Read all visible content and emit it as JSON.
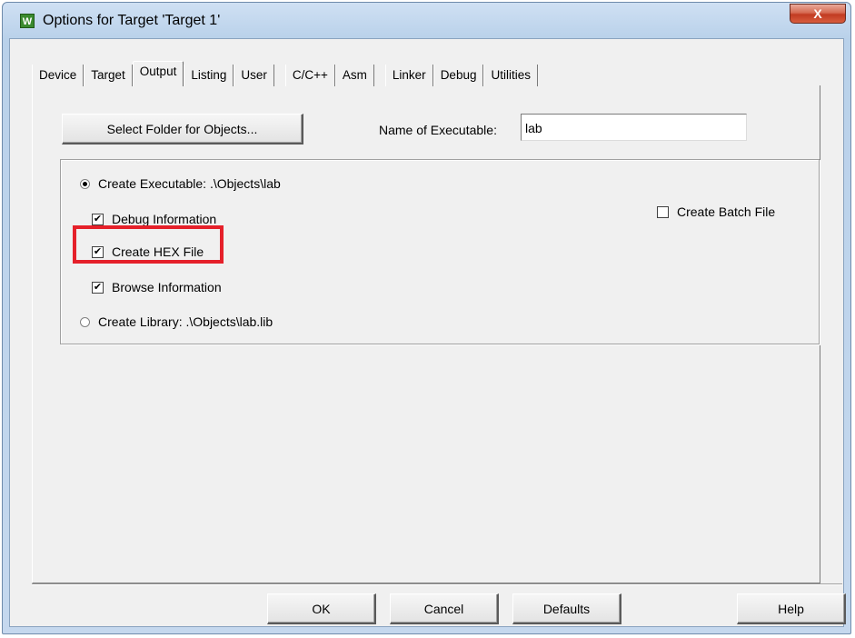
{
  "window": {
    "title": "Options for Target 'Target 1'",
    "icon_label": "W",
    "close_label": "X"
  },
  "tabs": [
    {
      "label": "Device",
      "active": false
    },
    {
      "label": "Target",
      "active": false
    },
    {
      "label": "Output",
      "active": true
    },
    {
      "label": "Listing",
      "active": false
    },
    {
      "label": "User",
      "active": false
    },
    {
      "label": "C/C++",
      "active": false
    },
    {
      "label": "Asm",
      "active": false
    },
    {
      "label": "Linker",
      "active": false
    },
    {
      "label": "Debug",
      "active": false
    },
    {
      "label": "Utilities",
      "active": false
    }
  ],
  "output": {
    "select_folder_label": "Select Folder for Objects...",
    "name_of_executable_label": "Name of Executable:",
    "name_of_executable_value": "lab",
    "create_executable_label": "Create Executable:  .\\Objects\\lab",
    "create_executable_selected": true,
    "debug_information_label": "Debug Information",
    "debug_information_checked": true,
    "create_hex_file_label": "Create HEX File",
    "create_hex_file_checked": true,
    "browse_information_label": "Browse Information",
    "browse_information_checked": true,
    "create_library_label": "Create Library:  .\\Objects\\lab.lib",
    "create_library_selected": false,
    "create_batch_file_label": "Create Batch File",
    "create_batch_file_checked": false
  },
  "highlight": {
    "target": "create-hex-file-checkbox",
    "color": "#e5202a"
  },
  "footer": {
    "ok_label": "OK",
    "cancel_label": "Cancel",
    "defaults_label": "Defaults",
    "help_label": "Help"
  }
}
